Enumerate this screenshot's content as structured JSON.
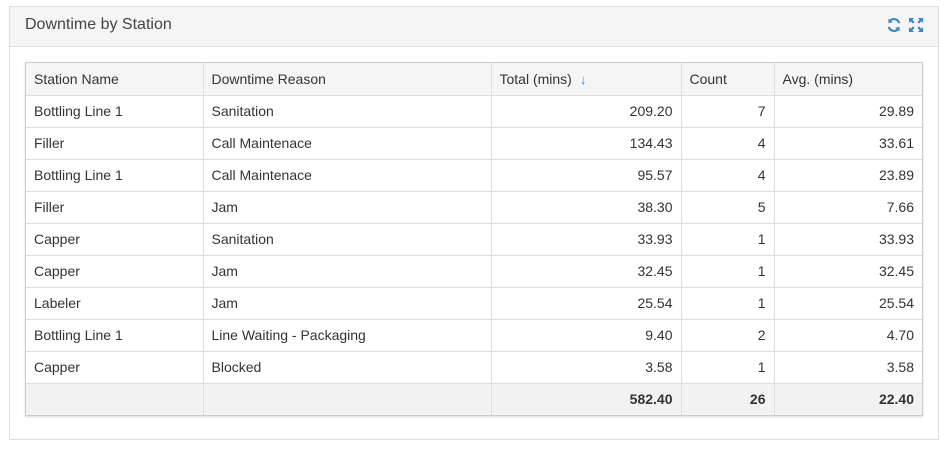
{
  "panel": {
    "title": "Downtime by Station",
    "tools": [
      {
        "name": "refresh-icon",
        "color": "#3a87c8"
      },
      {
        "name": "expand-icon",
        "color": "#3a87c8"
      }
    ]
  },
  "table": {
    "columns": [
      {
        "label": "Station Name"
      },
      {
        "label": "Downtime Reason"
      },
      {
        "label": "Total (mins)",
        "sorted": "desc",
        "sort_icon": "arrow-down-icon"
      },
      {
        "label": "Count"
      },
      {
        "label": "Avg. (mins)"
      }
    ],
    "rows": [
      {
        "station": "Bottling Line 1",
        "reason": "Sanitation",
        "total": "209.20",
        "count": "7",
        "avg": "29.89"
      },
      {
        "station": "Filler",
        "reason": "Call Maintenace",
        "total": "134.43",
        "count": "4",
        "avg": "33.61"
      },
      {
        "station": "Bottling Line 1",
        "reason": "Call Maintenace",
        "total": "95.57",
        "count": "4",
        "avg": "23.89"
      },
      {
        "station": "Filler",
        "reason": "Jam",
        "total": "38.30",
        "count": "5",
        "avg": "7.66"
      },
      {
        "station": "Capper",
        "reason": "Sanitation",
        "total": "33.93",
        "count": "1",
        "avg": "33.93"
      },
      {
        "station": "Capper",
        "reason": "Jam",
        "total": "32.45",
        "count": "1",
        "avg": "32.45"
      },
      {
        "station": "Labeler",
        "reason": "Jam",
        "total": "25.54",
        "count": "1",
        "avg": "25.54"
      },
      {
        "station": "Bottling Line 1",
        "reason": "Line Waiting - Packaging",
        "total": "9.40",
        "count": "2",
        "avg": "4.70"
      },
      {
        "station": "Capper",
        "reason": "Blocked",
        "total": "3.58",
        "count": "1",
        "avg": "3.58"
      }
    ],
    "totals": {
      "station": "",
      "reason": "",
      "total": "582.40",
      "count": "26",
      "avg": "22.40"
    }
  }
}
